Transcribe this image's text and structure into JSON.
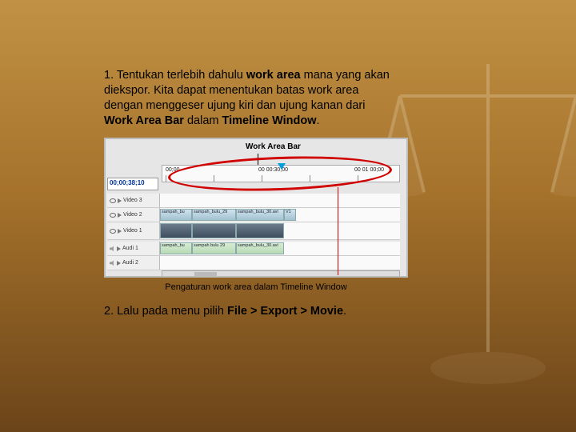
{
  "step1": {
    "prefix": "1. Tentukan terlebih dahulu ",
    "bold1": "work area",
    "mid1": " mana yang akan\ndiekspor. Kita dapat menentukan batas work area\ndengan menggeser ujung kiri dan ujung kanan dari\n ",
    "bold2": "Work Area Bar",
    "mid2": " dalam ",
    "bold3": "Timeline Window",
    "suffix": "."
  },
  "screenshot": {
    "wa_label": "Work Area Bar",
    "timecode": "00;00;38;10",
    "ruler_ticks": [
      "00;00",
      "00 00:30;00",
      "00 01 00;00"
    ],
    "tracks": {
      "v3": "Video 3",
      "v2": "Video 2",
      "v1": "Video 1",
      "a1": "Audi 1",
      "a2": "Audi 2"
    },
    "clips": {
      "v2a": "sampah_bu",
      "v2b": "sampah_bulu_29",
      "v2c": "sampah_bulu_30.avi",
      "v2d": "V1",
      "a1a": "sampah_bu",
      "a1b": "sampah bulu 29",
      "a1c": "sampah_bulu_30.avi"
    }
  },
  "caption": "Pengaturan work area dalam Timeline Window",
  "step2": {
    "prefix": "2. Lalu pada menu pilih ",
    "bold": "File > Export > Movie",
    "suffix": "."
  }
}
